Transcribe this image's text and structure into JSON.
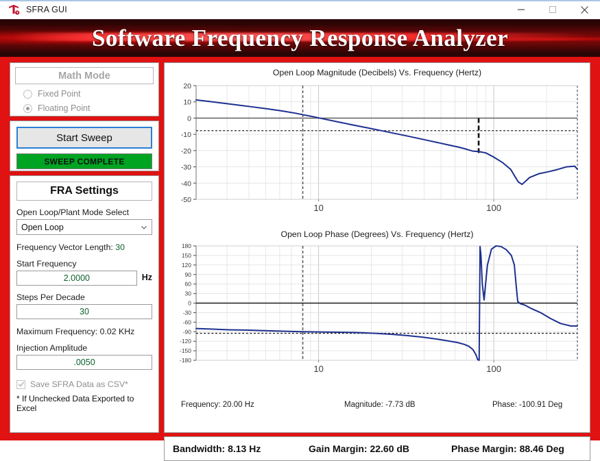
{
  "window": {
    "title": "SFRA GUI",
    "logo_icon": "ti-logo-icon",
    "minimize_icon": "minimize-icon",
    "maximize_icon": "maximize-icon",
    "close_icon": "close-icon"
  },
  "banner": {
    "title": "Software Frequency Response Analyzer"
  },
  "math_mode": {
    "title": "Math Mode",
    "options": [
      {
        "label": "Fixed Point",
        "selected": false
      },
      {
        "label": "Floating Point",
        "selected": true
      }
    ]
  },
  "sweep": {
    "start_button": "Start Sweep",
    "status": "SWEEP COMPLETE",
    "status_color": "#00a423"
  },
  "fra_settings": {
    "title": "FRA Settings",
    "mode_select_label": "Open Loop/Plant Mode Select",
    "mode_select_value": "Open Loop",
    "mode_select_options": [
      "Open Loop",
      "Plant"
    ],
    "chevron_icon": "chevron-down-icon",
    "frequency_vector_label": "Frequency Vector Length:",
    "frequency_vector_value": "30",
    "start_frequency_label": "Start Frequency",
    "start_frequency_value": "2.0000",
    "start_frequency_unit": "Hz",
    "steps_per_decade_label": "Steps Per Decade",
    "steps_per_decade_value": "30",
    "max_frequency_label": "Maximum Frequency:",
    "max_frequency_value": "0.02 KHz",
    "injection_amplitude_label": "Injection Amplitude",
    "injection_amplitude_value": ".0050",
    "save_csv_label": "Save SFRA Data as CSV*",
    "save_csv_checked": true,
    "check_icon": "check-icon",
    "footnote": "* If Unchecked Data Exported to Excel"
  },
  "cursor_readout": {
    "frequency": "Frequency: 20.00 Hz",
    "magnitude": "Magnitude: -7.73 dB",
    "phase": "Phase: -100.91 Deg"
  },
  "summary": {
    "bandwidth": "Bandwidth: 8.13 Hz",
    "gain_margin": "Gain Margin: 22.60 dB",
    "phase_margin": "Phase Margin: 88.46 Deg"
  },
  "chart_data": [
    {
      "type": "line",
      "name": "magnitude-plot",
      "title": "Open Loop Magnitude (Decibels) Vs. Frequency (Hertz)",
      "xlabel": "Frequency (Hertz)",
      "ylabel": "Magnitude (Decibels)",
      "xscale": "log",
      "xlim": [
        2,
        300
      ],
      "ylim": [
        -50,
        20
      ],
      "yticks": [
        20,
        10,
        0,
        -10,
        -20,
        -30,
        -40,
        -50
      ],
      "xticks": [
        10,
        100
      ],
      "grid": true,
      "line_color": "#1c2f8f",
      "markers": {
        "zero_db_line": 0,
        "cursor_h_line_db": -7.73,
        "cursor_v_line_hz": 8.13,
        "gain_margin_v_line_hz": 82
      },
      "x": [
        2,
        2.4,
        2.9,
        3.5,
        4.2,
        5.1,
        6.2,
        7.4,
        8.13,
        9,
        11,
        13,
        16,
        19,
        23,
        28,
        34,
        41,
        49,
        56,
        62,
        68,
        72,
        76,
        82,
        90,
        100,
        112,
        125,
        132,
        138,
        145,
        160,
        180,
        205,
        230,
        260,
        290,
        300
      ],
      "y": [
        11.2,
        10.2,
        9.1,
        8.0,
        6.9,
        5.7,
        4.4,
        3.0,
        2.1,
        1.2,
        -0.8,
        -2.4,
        -4.4,
        -6.0,
        -7.8,
        -9.7,
        -11.6,
        -13.5,
        -15.3,
        -16.7,
        -17.7,
        -18.8,
        -19.6,
        -20.3,
        -20.6,
        -21.4,
        -24.0,
        -27.3,
        -31.6,
        -35.9,
        -39.3,
        -40.8,
        -36.6,
        -34.3,
        -33.0,
        -31.7,
        -30.0,
        -29.6,
        -31.5
      ]
    },
    {
      "type": "line",
      "name": "phase-plot",
      "title": "Open Loop Phase (Degrees) Vs. Frequency (Hertz)",
      "xlabel": "Frequency (Hertz)",
      "ylabel": "Phase (Degrees)",
      "xscale": "log",
      "xlim": [
        2,
        300
      ],
      "ylim": [
        -180,
        180
      ],
      "yticks": [
        180,
        150,
        120,
        90,
        60,
        30,
        0,
        -30,
        -60,
        -90,
        -120,
        -150,
        -180
      ],
      "xticks": [
        10,
        100
      ],
      "grid": true,
      "line_color": "#1c2f8f",
      "markers": {
        "zero_deg_line": 0,
        "cursor_h_line_deg": -95,
        "cursor_v_line_hz": 8.13
      },
      "x": [
        2,
        2.5,
        3.1,
        3.9,
        4.8,
        6,
        7.4,
        8.13,
        9.5,
        11,
        14,
        17,
        21,
        26,
        32,
        39,
        47,
        55,
        62,
        68,
        72,
        76,
        79,
        81,
        82.5,
        83.5,
        84.5,
        85,
        86,
        88,
        92,
        97,
        103,
        110,
        118,
        126,
        131,
        134,
        137,
        142,
        150,
        165,
        185,
        210,
        240,
        275,
        300
      ],
      "y": [
        -80,
        -82,
        -84,
        -85,
        -86.5,
        -88,
        -89.5,
        -90,
        -90.5,
        -91,
        -92,
        -93,
        -95,
        -98,
        -102,
        -107,
        -113,
        -119,
        -124,
        -130,
        -136,
        -146,
        -162,
        -178,
        -180,
        178,
        150,
        120,
        60,
        10,
        120,
        170,
        180,
        178,
        168,
        150,
        120,
        60,
        5,
        -2,
        -6,
        -18,
        -30,
        -48,
        -64,
        -72,
        -72
      ]
    }
  ]
}
